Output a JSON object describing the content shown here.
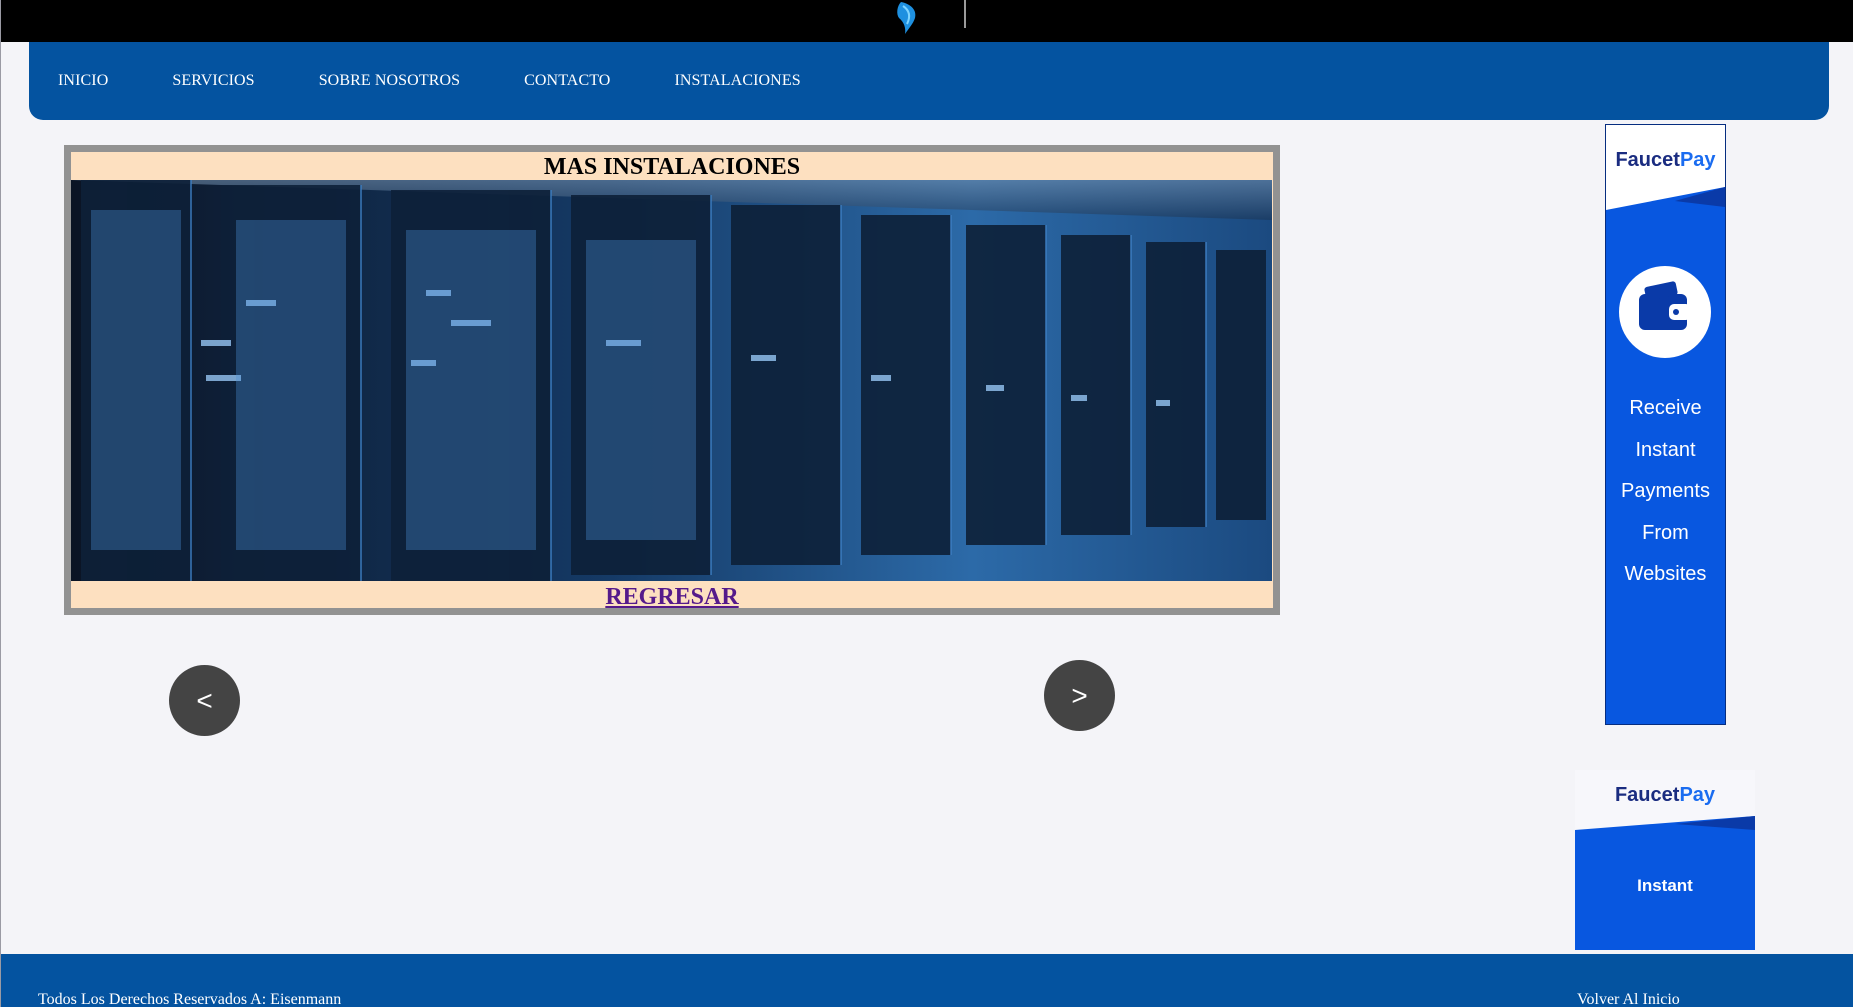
{
  "header": {
    "logo_icon": "feather-logo-icon"
  },
  "nav": {
    "items": [
      {
        "label": "INICIO"
      },
      {
        "label": "SERVICIOS"
      },
      {
        "label": "SOBRE NOSOTROS"
      },
      {
        "label": "CONTACTO"
      },
      {
        "label": "INSTALACIONES"
      }
    ]
  },
  "gallery": {
    "title": "MAS INSTALACIONES",
    "back_link": "REGRESAR",
    "prev_label": "<",
    "next_label": ">"
  },
  "ads": {
    "tall": {
      "brand_part1": "Faucet",
      "brand_part2": "Pay",
      "lines": [
        "Receive",
        "Instant",
        "Payments",
        "From",
        "Websites"
      ],
      "icon": "wallet-icon"
    },
    "small": {
      "brand_part1": "Faucet",
      "brand_part2": "Pay",
      "text": "Instant"
    }
  },
  "footer": {
    "copyright": "Todos Los Derechos Reservados A: Eisenmann",
    "back_to_top": "Volver Al Inicio"
  },
  "colors": {
    "nav_blue": "#0453a0",
    "banner_peach": "#fde0c0",
    "ad_blue": "#0857e0",
    "link_purple": "#551a8b"
  }
}
